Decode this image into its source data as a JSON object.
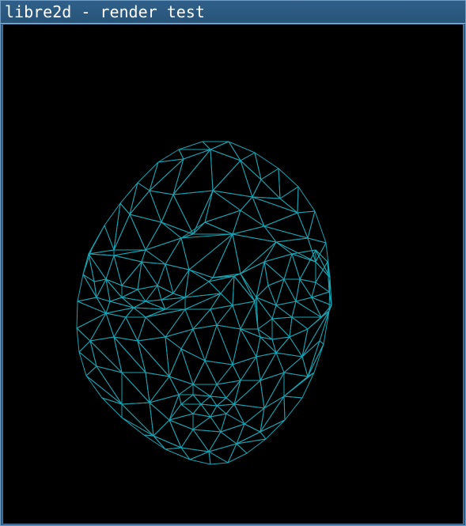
{
  "window": {
    "title": "libre2d - render test"
  },
  "viewport": {
    "background": "#000000",
    "wire_color": "#18a3b2",
    "content": "face-wireframe-mesh"
  }
}
